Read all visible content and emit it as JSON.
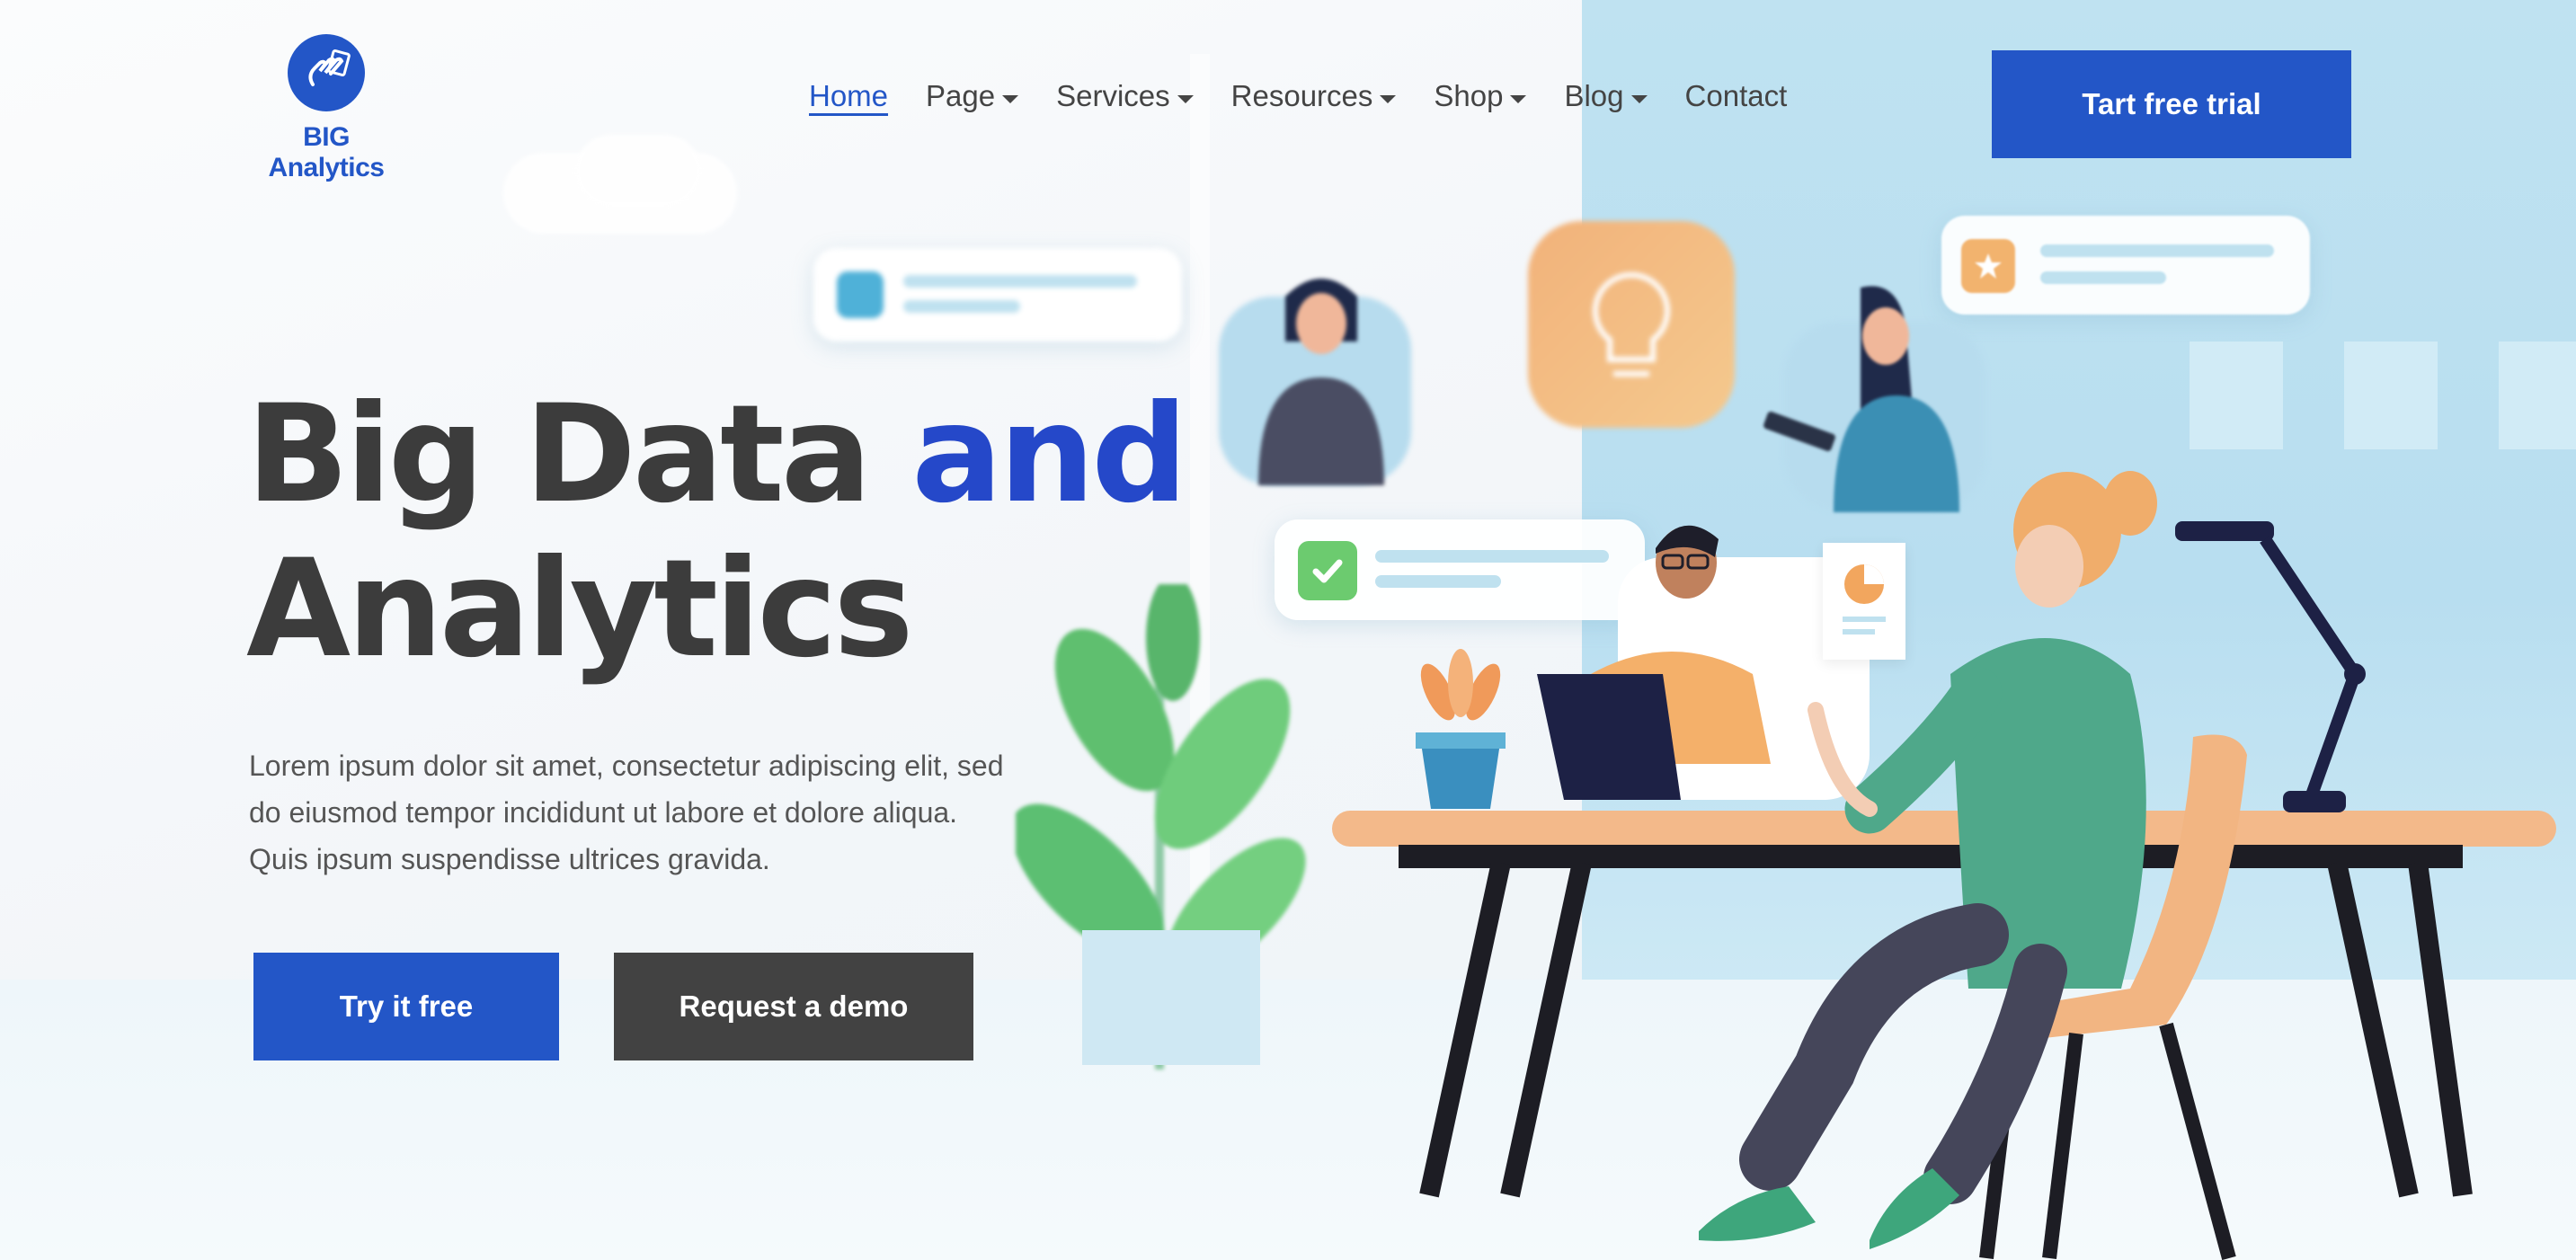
{
  "brand": {
    "name": "BIG Analytics",
    "logo_icon": "hand-document-logo-icon",
    "color": "#2356c7"
  },
  "nav": {
    "items": [
      {
        "label": "Home",
        "active": true,
        "dropdown": false
      },
      {
        "label": "Page",
        "active": false,
        "dropdown": true
      },
      {
        "label": "Services",
        "active": false,
        "dropdown": true
      },
      {
        "label": "Resources",
        "active": false,
        "dropdown": true
      },
      {
        "label": "Shop",
        "active": false,
        "dropdown": true
      },
      {
        "label": "Blog",
        "active": false,
        "dropdown": true
      },
      {
        "label": "Contact",
        "active": false,
        "dropdown": false
      }
    ]
  },
  "header": {
    "cta_label": "Tart free trial"
  },
  "hero": {
    "title_part1": "Big Data ",
    "title_accent": "and",
    "title_part2": "Analytics",
    "description": "Lorem ipsum dolor sit amet, consectetur adipiscing elit, sed do eiusmod tempor incididunt ut labore et dolore aliqua. Quis ipsum suspendisse ultrices gravida.",
    "primary_button": "Try it free",
    "secondary_button": "Request a demo"
  },
  "colors": {
    "primary": "#2356c7",
    "accent_text": "#2548c9",
    "dark_button": "#424242",
    "heading": "#3c3c3c"
  },
  "illustration": {
    "icons": [
      "lightbulb-icon",
      "checkmark-icon",
      "star-icon",
      "pie-chart-icon"
    ]
  }
}
